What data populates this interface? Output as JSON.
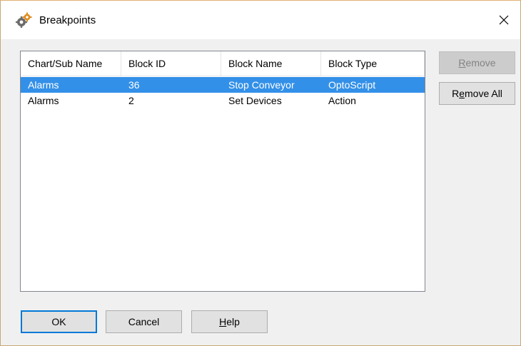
{
  "window": {
    "title": "Breakpoints",
    "app_icon": "gears-icon",
    "close_glyph": "✕"
  },
  "list": {
    "columns": [
      "Chart/Sub Name",
      "Block ID",
      "Block Name",
      "Block Type"
    ],
    "rows": [
      {
        "chart": "Alarms",
        "block_id": "36",
        "block_name": "Stop Conveyor",
        "block_type": "OptoScript",
        "selected": true
      },
      {
        "chart": "Alarms",
        "block_id": "2",
        "block_name": "Set Devices",
        "block_type": "Action",
        "selected": false
      }
    ],
    "selection_color": "#3390e8"
  },
  "buttons": {
    "remove": {
      "first": "R",
      "rest": "emove",
      "enabled": false
    },
    "remove_all": {
      "pre": "R",
      "under": "e",
      "post": "move All"
    },
    "ok": "OK",
    "cancel": "Cancel",
    "help": {
      "first": "H",
      "rest": "elp"
    }
  }
}
